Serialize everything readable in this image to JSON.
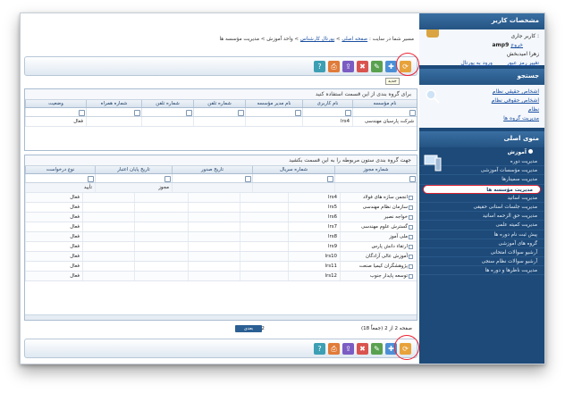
{
  "sidebar": {
    "user_header": "مشخصات کاربر",
    "user_label": "کاربر جاری :",
    "user_name": "amp9",
    "exit_link": "خروج",
    "full_name": "زهرا امیدبخش",
    "change_password": "تغییر رمز عبور",
    "portal_login": "ورود به پورتال",
    "search_header": "جستجو",
    "search_items": [
      "اشخاص حقیقی نظام",
      "اشخاص حقوقی نظام",
      "نظام",
      "مدیریت گروه ها"
    ],
    "system_header": "منوی اصلی",
    "category": "آموزش",
    "menu_items": [
      "مدیریت دوره",
      "مدیریت مؤسسات آموزشی",
      "مدیریت سمینارها",
      "مدیریت مؤسسه ها",
      "مدیریت اساتید",
      "مدیریت جلسات استانی حقیقی",
      "مدیریت حق الزحمه اساتید",
      "مدیریت کمیته علمی",
      "پیش ثبت نام دوره ها",
      "گروه های آموزشی",
      "آرشیو سوالات امتحانی",
      "آرشیو سوالات نظام سنجی",
      "مدیریت ناظرها و دوره ها"
    ],
    "active_index": 3
  },
  "breadcrumb": {
    "prefix": "مسیر شما در سایت :",
    "home": "صفحه اصلی",
    "portal": "پورتال کارشناس",
    "edu": "واحد آموزش",
    "current": "مدیریت مؤسسه ها"
  },
  "top_grid": {
    "group_hint": "برای گروه بندی از این قسمت استفاده کنید",
    "columns": [
      "نام مؤسسه",
      "نام کاربری",
      "نام مدیر مؤسسه",
      "شماره تلفن",
      "شماره تلفن",
      "شماره همراه",
      "وضعیت"
    ],
    "row": [
      "شرکت پارسیان مهندسی",
      "lrs4",
      "",
      "",
      "",
      "",
      "فعال"
    ]
  },
  "bottom_grid": {
    "group_hint": "جهت گروه بندی ستون مربوطه را به این قسمت بکشید",
    "columns": [
      "شماره مجوز",
      "شماره سریال",
      "تاریخ صدور",
      "تاریخ پایان اعتبار",
      "نوع درخواست"
    ],
    "status_row": [
      "",
      "",
      "",
      "مجوز",
      "تأیید"
    ],
    "rows": [
      [
        "انجمن سازه های فولاد",
        "lrs4",
        "فعال"
      ],
      [
        "سازمان نظام مهندسی",
        "lrs5",
        "فعال"
      ],
      [
        "خواجه نصیر",
        "lrs6",
        "فعال"
      ],
      [
        "گسترش علوم مهندسی",
        "lrs7",
        "فعال"
      ],
      [
        "ملی آموز",
        "lrs8",
        "فعال"
      ],
      [
        "ارتقاء دانش پارس",
        "lrs9",
        "فعال"
      ],
      [
        "آموزش عالی آزادگان",
        "lrs10",
        "فعال"
      ],
      [
        "پژوهشگران کیمیا صنعت",
        "lrs11",
        "فعال"
      ],
      [
        "توسعه پایدار جنوب",
        "lrs12",
        "فعال"
      ]
    ]
  },
  "pager": {
    "info": "صفحه 2 از 2 (جمعاً 18)",
    "pages": "1  2",
    "nav_label": "بعدی"
  },
  "toolbar_icons": [
    "refresh-icon",
    "add-icon",
    "edit-icon",
    "delete-icon",
    "export-icon",
    "print-icon",
    "help-icon"
  ],
  "tooltip": "جدید"
}
